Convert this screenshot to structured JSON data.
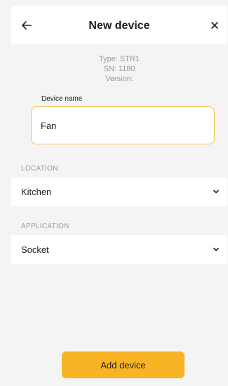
{
  "header": {
    "title": "New device",
    "back_icon": "arrow-left-icon",
    "close_icon": "close-icon"
  },
  "device_info": {
    "type": "Type: STR1",
    "sn": "SN: 1180",
    "version": "Version:"
  },
  "device_name": {
    "label": "Device name",
    "value": "Fan"
  },
  "location": {
    "section_label": "LOCATION",
    "selected": "Kitchen"
  },
  "application": {
    "section_label": "APPLICATION",
    "selected": "Socket"
  },
  "actions": {
    "add_device": "Add device"
  },
  "colors": {
    "accent": "#f8b424",
    "input_border": "#f3c64c",
    "background": "#f4f4f4",
    "surface": "#ffffff"
  }
}
